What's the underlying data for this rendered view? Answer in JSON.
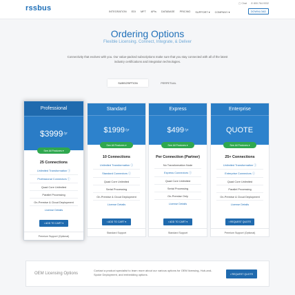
{
  "header": {
    "logo": "rssbus",
    "chat": "Chat",
    "phone": "800.764.9332",
    "nav": [
      "INTEGRATION",
      "EDI",
      "MFT",
      "APIs",
      "DATABASE",
      "PRICING",
      "SUPPORT ▾",
      "COMPANY ▾"
    ],
    "download": "DOWNLOAD"
  },
  "hero": {
    "title": "Ordering Options",
    "subtitle": "Flexible Licensing. Connect, Integrate, & Deliver",
    "intro": "Connectivity that evolves with you. Our value-packed subscriptions make sure that you stay connected with all of the latest industry certifications and integration technologies."
  },
  "tabs": [
    "SUBSCRIPTION",
    "PERPETUAL"
  ],
  "plans": [
    {
      "name": "Professional",
      "price": "$3999",
      "unit": "/yr",
      "features_btn": "See All Features ▾",
      "connections": "25 Connections",
      "rows": [
        "Unlimited Transformation ⓘ",
        "Professional Connectors ⓘ",
        "Quad Core Unlimited",
        "Parallel Processing",
        "On-Premise & Cloud Deployment",
        "License Details"
      ],
      "cart": "▪ ADD TO CART ▾",
      "support": "Premium Support (Optional)"
    },
    {
      "name": "Standard",
      "price": "$1999",
      "unit": "/yr",
      "features_btn": "See All Features ▾",
      "connections": "10 Connections",
      "rows": [
        "Unlimited Transformation ⓘ",
        "Standard Connectors ⓘ",
        "Quad Core Unlimited",
        "Serial Processing",
        "On-Premise & Cloud Deployment",
        "License Details"
      ],
      "cart": "▪ ADD TO CART ▾",
      "support": "Standard Support"
    },
    {
      "name": "Express",
      "price": "$499",
      "unit": "/yr",
      "features_btn": "See All Features ▾",
      "connections": "Per Connection (Partner)",
      "rows": [
        "No Transformation Node",
        "Express Connectors ⓘ",
        "Quad Core Unlimited",
        "Serial Processing",
        "On-Premise Only",
        "License Details"
      ],
      "cart": "▪ ADD TO CART ▾",
      "support": "Standard Support"
    },
    {
      "name": "Enterprise",
      "price": "QUOTE",
      "unit": "",
      "features_btn": "See All Features ▾",
      "connections": "25+ Connections",
      "rows": [
        "Unlimited Transformation ⓘ",
        "Enterprise Connectors ⓘ",
        "Quad Core Unlimited",
        "Parallel Processing",
        "On-Premise & Cloud Deployment",
        "License Details"
      ],
      "cart": "▪ REQUEST QUOTE",
      "support": "Premium Support (Optional)"
    }
  ],
  "oem": {
    "title": "OEM Licensing Options",
    "text": "Contact a product specialist to learn more about our various options for OEM licensing, Hub-and-Spoke Deployment, and embedding options.",
    "button": "▪ REQUEST QUOTE"
  },
  "colors": {
    "brand": "#1e6fb8",
    "cta": "#2fa84f"
  }
}
